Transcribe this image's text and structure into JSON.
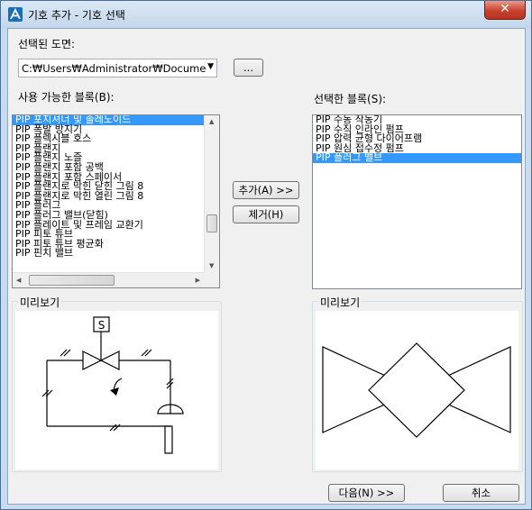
{
  "window": {
    "title": "기호 추가 - 기호 선택",
    "close_label": "✕"
  },
  "drawing": {
    "label": "선택된 도면:",
    "path": "C:₩Users₩Administrator₩Docume",
    "browse_label": "..."
  },
  "available": {
    "label": "사용 가능한 블록(B):",
    "items": [
      "PIP 포지셔너 및 솔레노이드",
      "PIP 폭발 방지기",
      "PIP 플렉시블 호스",
      "PIP 플랜지",
      "PIP 플랜지 노즐",
      "PIP 플랜지 포함 공백",
      "PIP 플랜지 포함 스페이서",
      "PIP 플랜지로 막힌 닫힌 그림 8",
      "PIP 플랜지로 막힌 열린 그림 8",
      "PIP 플러그",
      "PIP 플러그 밸브(닫힘)",
      "PIP 플레이트 및 프레임 교환기",
      "PIP 피토 튜브",
      "PIP 피토 튜브 평균화",
      "PIP 핀치 밸브"
    ],
    "selected_index": 0
  },
  "selected": {
    "label": "선택한 블록(S):",
    "items": [
      "PIP 수동 작동기",
      "PIP 수직 인라인 펌프",
      "PIP 압력 균형 다이어프램",
      "PIP 원심 접수정 펌프",
      "PIP 플러그 밸브"
    ],
    "selected_index": 4
  },
  "actions": {
    "add_label": "추가(A) >>",
    "remove_label": "제거(H)"
  },
  "preview_left": {
    "label": "미리보기",
    "symbol_letter": "S"
  },
  "preview_right": {
    "label": "미리보기"
  },
  "footer": {
    "next_label": "다음(N) >>",
    "cancel_label": "취소"
  }
}
